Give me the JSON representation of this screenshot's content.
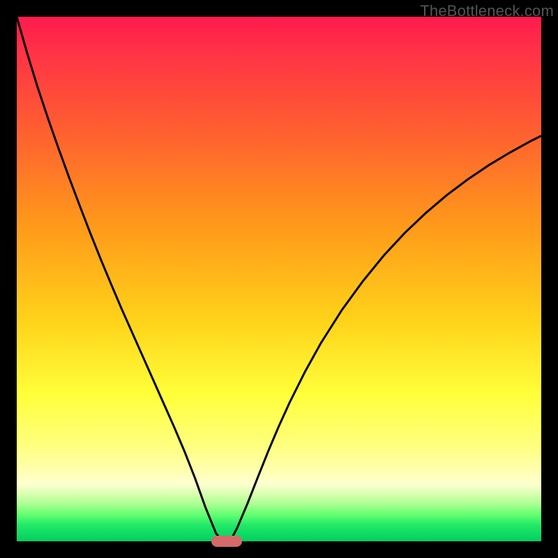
{
  "watermark": "TheBottleneck.com",
  "colors": {
    "background": "#000000",
    "gradient_top": "#ff1a4d",
    "gradient_bottom": "#00d060",
    "curve": "#000000",
    "marker": "#d46a6a"
  },
  "chart_data": {
    "type": "line",
    "title": "",
    "xlabel": "",
    "ylabel": "",
    "xlim": [
      0,
      100
    ],
    "ylim": [
      0,
      100
    ],
    "series": [
      {
        "name": "left-branch",
        "x": [
          0,
          2,
          4,
          6,
          8,
          10,
          12,
          14,
          16,
          18,
          20,
          22,
          24,
          26,
          28,
          30,
          32,
          34,
          36,
          38,
          39,
          40
        ],
        "values": [
          100,
          93,
          86.5,
          80.5,
          74.8,
          69.3,
          64,
          58.8,
          53.8,
          49,
          44.3,
          39.8,
          35.3,
          30.8,
          26.3,
          21.8,
          17.1,
          12,
          6.4,
          1.5,
          0.3,
          0
        ]
      },
      {
        "name": "right-branch",
        "x": [
          40,
          41,
          42,
          44,
          46,
          48,
          50,
          52,
          55,
          58,
          62,
          66,
          70,
          74,
          78,
          82,
          86,
          90,
          94,
          98,
          100
        ],
        "values": [
          0,
          0.6,
          2.5,
          7.2,
          12.3,
          17.3,
          22,
          26.4,
          32.4,
          37.8,
          44.1,
          49.6,
          54.5,
          58.8,
          62.6,
          66,
          69,
          71.7,
          74.1,
          76.3,
          77.3
        ]
      }
    ],
    "marker": {
      "x": 40,
      "y": 0
    },
    "annotations": []
  }
}
